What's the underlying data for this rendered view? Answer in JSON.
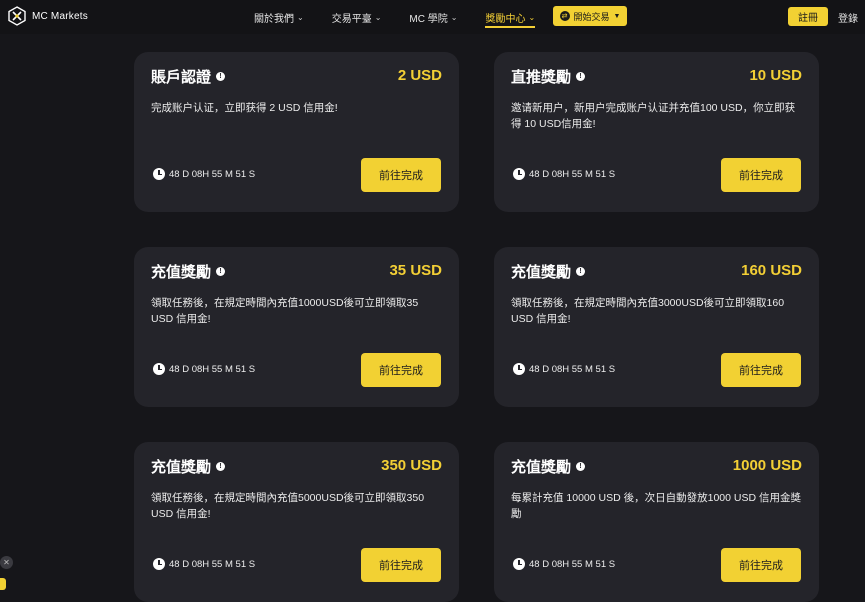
{
  "header": {
    "logo_text": "MC Markets",
    "nav": [
      {
        "label": "關於我們",
        "active": false
      },
      {
        "label": "交易平臺",
        "active": false
      },
      {
        "label": "MC 學院",
        "active": false
      },
      {
        "label": "獎勵中心",
        "active": true
      }
    ],
    "trade_button": "開始交易",
    "register_button": "註冊",
    "login_link": "登錄"
  },
  "action_label": "前往完成",
  "cards": [
    {
      "title": "賬戶認證",
      "amount": "2 USD",
      "desc": "完成账户认证，立即获得 2 USD 信用金!",
      "timer": "48 D 08H 55 M 51 S"
    },
    {
      "title": "直推獎勵",
      "amount": "10 USD",
      "desc": "邀请新用户，新用户完成账户认证并充值100 USD，你立即获得 10 USD信用金!",
      "timer": "48 D 08H 55 M 51 S"
    },
    {
      "title": "充值獎勵",
      "amount": "35 USD",
      "desc": "領取任務後，在規定時間內充值1000USD後可立即領取35 USD 信用金!",
      "timer": "48 D 08H 55 M 51 S"
    },
    {
      "title": "充值獎勵",
      "amount": "160 USD",
      "desc": "領取任務後，在規定時間內充值3000USD後可立即領取160 USD 信用金!",
      "timer": "48 D 08H 55 M 51 S"
    },
    {
      "title": "充值獎勵",
      "amount": "350 USD",
      "desc": "領取任務後，在規定時間內充值5000USD後可立即領取350 USD 信用金!",
      "timer": "48 D 08H 55 M 51 S"
    },
    {
      "title": "充值獎勵",
      "amount": "1000 USD",
      "desc": "每累計充值 10000 USD 後，次日自動發放1000 USD 信用金獎勵",
      "timer": "48 D 08H 55 M 51 S"
    }
  ]
}
